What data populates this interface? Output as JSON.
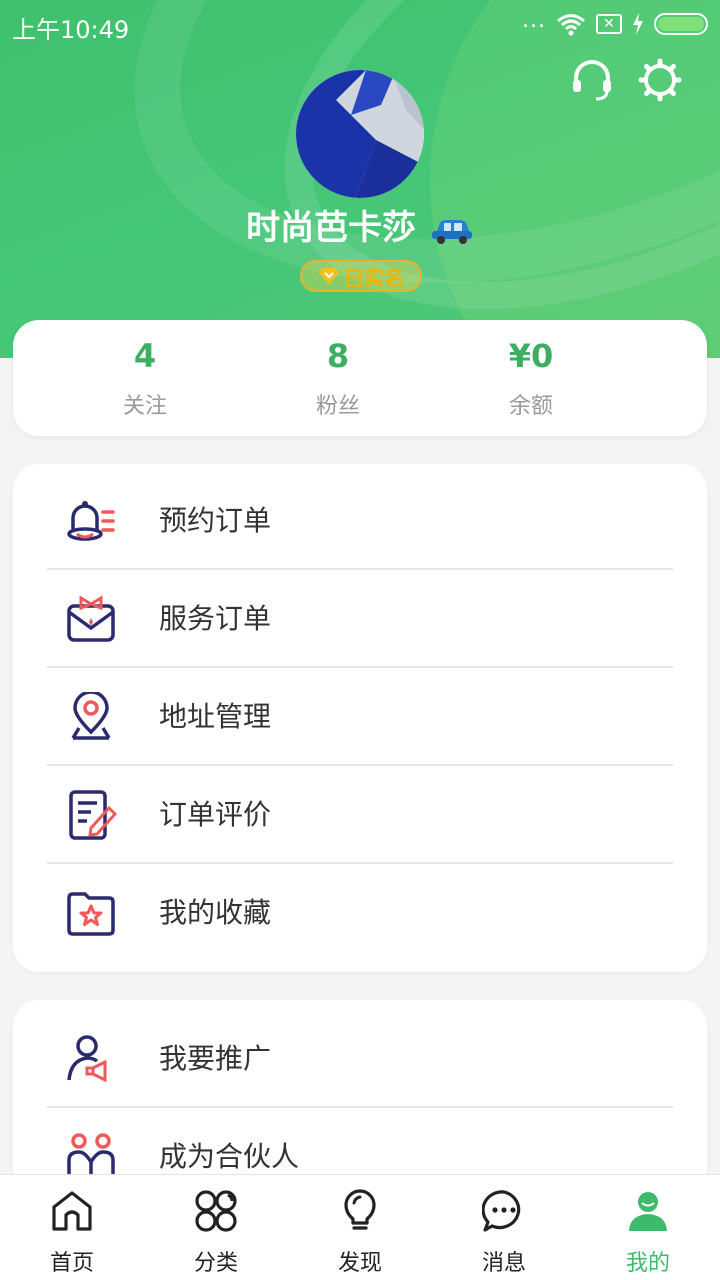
{
  "status_bar": {
    "time": "上午10:49",
    "dots": "...",
    "sim": "✕"
  },
  "header": {
    "icons": [
      "headset-icon",
      "settings-icon"
    ]
  },
  "profile": {
    "name": "时尚芭卡莎",
    "badge": "已实名"
  },
  "stats": [
    {
      "value": "4",
      "label": "关注"
    },
    {
      "value": "8",
      "label": "粉丝"
    },
    {
      "value": "¥0",
      "label": "余额"
    }
  ],
  "menu1": [
    {
      "label": "预约订单",
      "icon": "bell-list-icon"
    },
    {
      "label": "服务订单",
      "icon": "service-box-icon"
    },
    {
      "label": "地址管理",
      "icon": "location-pin-icon"
    },
    {
      "label": "订单评价",
      "icon": "edit-document-icon"
    },
    {
      "label": "我的收藏",
      "icon": "star-folder-icon"
    }
  ],
  "menu2": [
    {
      "label": "我要推广",
      "icon": "promote-user-icon"
    },
    {
      "label": "成为合伙人",
      "icon": "partners-icon"
    }
  ],
  "tabbar": [
    {
      "label": "首页",
      "icon": "home-icon"
    },
    {
      "label": "分类",
      "icon": "category-icon"
    },
    {
      "label": "发现",
      "icon": "lightbulb-icon"
    },
    {
      "label": "消息",
      "icon": "chat-bubble-icon"
    },
    {
      "label": "我的",
      "icon": "user-icon",
      "active": true
    }
  ],
  "colors": {
    "accent": "#3dbb6c",
    "navy": "#2b2a6e",
    "coral": "#f0595b"
  }
}
